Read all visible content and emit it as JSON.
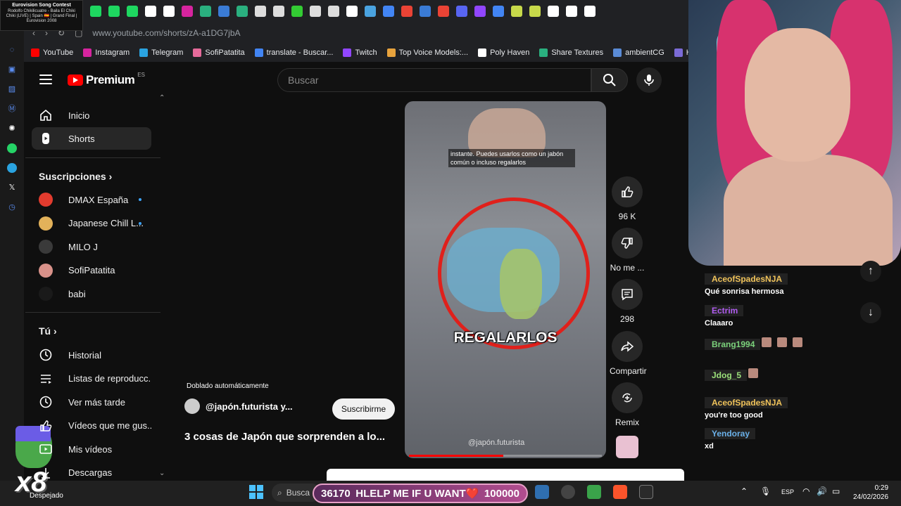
{
  "browser": {
    "song_card": {
      "title": "Eurovision Song Contest",
      "detail": "Rodolfo Chikilicuatre - Baila El Chiki Chiki (LIVE) | Spain 🇪🇸 | Grand Final | Eurovision 2008"
    },
    "url": "www.youtube.com/shorts/zA-a1DG7jbA",
    "bookmarks": [
      {
        "label": "YouTube",
        "color": "#ff0000"
      },
      {
        "label": "Instagram",
        "color": "#d6249f"
      },
      {
        "label": "Telegram",
        "color": "#2aa3e0"
      },
      {
        "label": "SofiPatatita",
        "color": "#e56a9a"
      },
      {
        "label": "translate - Buscar...",
        "color": "#4285f4"
      },
      {
        "label": "Twitch",
        "color": "#9146ff"
      },
      {
        "label": "Top Voice Models:...",
        "color": "#e8a33d"
      },
      {
        "label": "Poly Haven",
        "color": "#ffffff"
      },
      {
        "label": "Share Textures",
        "color": "#2ab07f"
      },
      {
        "label": "ambientCG",
        "color": "#5a8bd6"
      },
      {
        "label": "Ha",
        "color": "#7b6bd6"
      }
    ]
  },
  "youtube": {
    "logo_text": "Premium",
    "region": "ES",
    "search_placeholder": "Buscar",
    "sidebar": {
      "main": [
        {
          "label": "Inicio",
          "icon": "home-icon"
        },
        {
          "label": "Shorts",
          "icon": "shorts-icon",
          "active": true
        }
      ],
      "subs_heading": "Suscripciones",
      "subscriptions": [
        {
          "label": "DMAX España",
          "color": "#e23b2e",
          "new": true
        },
        {
          "label": "Japanese Chill L...",
          "color": "#e3b25a",
          "new": true
        },
        {
          "label": "MILO J",
          "color": "#3a3a3a",
          "new": false
        },
        {
          "label": "SofiPatatita",
          "color": "#d9928a",
          "new": false
        },
        {
          "label": "babi",
          "color": "#1a1a1a",
          "new": false
        }
      ],
      "you_heading": "Tú",
      "you": [
        {
          "label": "Historial",
          "icon": "history-icon"
        },
        {
          "label": "Listas de reproducc...",
          "icon": "playlist-icon"
        },
        {
          "label": "Ver más tarde",
          "icon": "clock-icon"
        },
        {
          "label": "Vídeos que me gus...",
          "icon": "like-icon"
        },
        {
          "label": "Mis vídeos",
          "icon": "my-videos-icon"
        },
        {
          "label": "Descargas",
          "icon": "download-icon"
        }
      ]
    },
    "short": {
      "subtitle": "instante. Puedes usarlos como un jabón común o incluso regalarlos",
      "caption": "REGALARLOS",
      "watermark": "@japón.futurista",
      "progress": 0.49,
      "dubbed_label": "Doblado automáticamente",
      "channel": "@japón.futurista y...",
      "subscribe": "Suscribirme",
      "title": "3 cosas de Japón que sorprenden a lo..."
    },
    "actions": [
      {
        "label": "96 K",
        "icon": "like-icon"
      },
      {
        "label": "No me ...",
        "icon": "dislike-icon"
      },
      {
        "label": "298",
        "icon": "comment-icon"
      },
      {
        "label": "Compartir",
        "icon": "share-icon"
      },
      {
        "label": "Remix",
        "icon": "remix-icon"
      }
    ]
  },
  "chat": [
    {
      "user": "AceofSpadesNJA",
      "color": "#f0c35a",
      "text": "Qué sonrisa hermosa",
      "emotes": 0
    },
    {
      "user": "Ectrim",
      "color": "#b05cf0",
      "text": "Claaaro",
      "emotes": 0
    },
    {
      "user": "Brang1994",
      "color": "#7bd17b",
      "text": "",
      "emotes": 3
    },
    {
      "user": "Jdog_5",
      "color": "#9be07a",
      "text": "",
      "emotes": 1
    },
    {
      "user": "AceofSpadesNJA",
      "color": "#f0c35a",
      "text": "you're too good",
      "emotes": 0
    },
    {
      "user": "Yendoray",
      "color": "#6ab0e8",
      "text": "xd",
      "emotes": 0
    }
  ],
  "overlay": {
    "goal_current": "36170",
    "goal_text": "HLELP ME IF U WANT❤️",
    "goal_target": "100000",
    "multiplier": "x8"
  },
  "taskbar": {
    "weather": "Despejado",
    "search": "Busca",
    "lang": "ESP",
    "time": "0:29",
    "date": "24/02/2026"
  }
}
